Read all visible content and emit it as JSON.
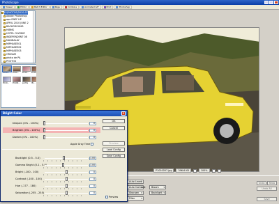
{
  "app": {
    "title": "PhotoScape"
  },
  "menu": [
    "Viewer",
    "Editor",
    "Batch Editor",
    "Page",
    "Combine",
    "Animated GIF",
    "Print",
    "Photoshop"
  ],
  "tree": {
    "items": [
      "E:\\PHOTOS\\2010-07",
      "Adobe Photoshop",
      "apa ENEF HP",
      "APRIL 2010 JUNE 2",
      "BACKGROUND",
      "HIBMS",
      "HOTEL OLYMBIY",
      "INDEPENDENT 08",
      "MANDALAY",
      "MIPHASEE01",
      "MIPHASEE02",
      "MIPHASEE03",
      "ORIGAM",
      "photo de PA",
      "PHOTOS",
      "Ruby"
    ],
    "selected_index": 0
  },
  "thumbs": [
    {
      "caption": "PC10..."
    },
    {
      "caption": "PC10..."
    },
    {
      "caption": "PC10..."
    },
    {
      "caption": "PC10..."
    },
    {
      "caption": "PC10..."
    },
    {
      "caption": "PC100..."
    },
    {
      "caption": "profile"
    },
    {
      "caption": "Ifk..."
    }
  ],
  "status": {
    "filename": "P1010057.jpg",
    "size": "396.6 KB",
    "zoom": "100%"
  },
  "dialog": {
    "title": "Bright Color",
    "rows": [
      {
        "label": "Deepen (0% - 100%)",
        "value": "0"
      },
      {
        "label": "Brighten (0% - 100%)",
        "value": "0"
      },
      {
        "label": "Darken (0% - 100%)",
        "value": "0"
      }
    ],
    "sliders": [
      {
        "label": "Backlight (0.5 - 5.0)",
        "value": "1.00"
      },
      {
        "label": "Gamma Bright (0.1 - 5.0)",
        "value": "1.00"
      },
      {
        "label": "Bright (-100 - 100)",
        "value": "0"
      },
      {
        "label": "Contrast (-100 - 100)",
        "value": "0"
      },
      {
        "label": "Hue (-177 - 180)",
        "value": "0"
      },
      {
        "label": "Saturation (-255 - 255)",
        "value": "0"
      }
    ],
    "buttons": {
      "ok": "OK",
      "cancel": "Cancel",
      "preview": "Preview",
      "load": "Load Config",
      "save": "Save Config"
    },
    "apply_label": "Apple Gray Time",
    "preview_label": "Preview"
  },
  "bottom": {
    "buttons": [
      "Auto Level",
      "Auto Contrast",
      "Sharpen",
      "Filter",
      "Bloom",
      "Backlight"
    ],
    "right": [
      "Undo",
      "Redo",
      "Undo All",
      "Save"
    ]
  },
  "colors": {
    "photo_sky": "#f4f0e0",
    "car": "#e6d232",
    "hi_row": "#f4b4b4"
  }
}
